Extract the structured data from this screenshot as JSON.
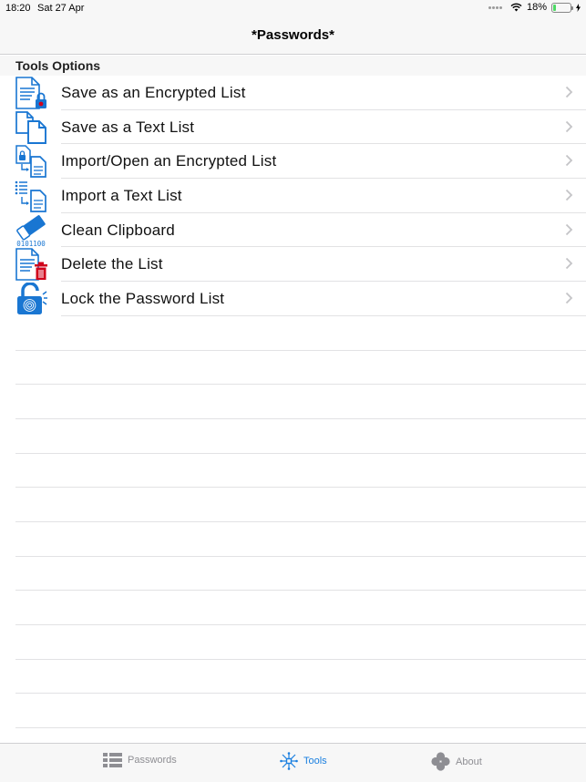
{
  "status_bar": {
    "time": "18:20",
    "date": "Sat 27 Apr",
    "battery_percent": "18%",
    "battery_level": 0.18,
    "icons": [
      "signal-dots-icon",
      "wifi-icon",
      "battery-icon",
      "charging-icon"
    ]
  },
  "nav": {
    "title": "*Passwords*"
  },
  "section": {
    "header": "Tools Options"
  },
  "tools": [
    {
      "label": "Save as an Encrypted List",
      "icon": "encrypted-document-icon"
    },
    {
      "label": "Save as a Text List",
      "icon": "copy-documents-icon"
    },
    {
      "label": "Import/Open an Encrypted List",
      "icon": "import-encrypted-icon"
    },
    {
      "label": "Import a Text List",
      "icon": "import-text-icon"
    },
    {
      "label": "Clean Clipboard",
      "icon": "eraser-binary-icon",
      "icon_text": "0101100"
    },
    {
      "label": "Delete the List",
      "icon": "delete-document-icon"
    },
    {
      "label": "Lock the Password List",
      "icon": "fingerprint-lock-icon"
    }
  ],
  "tab_bar": {
    "tabs": [
      {
        "label": "Passwords",
        "icon": "list-icon",
        "active": false
      },
      {
        "label": "Tools",
        "icon": "tools-network-icon",
        "active": true
      },
      {
        "label": "About",
        "icon": "clover-icon",
        "active": false
      }
    ]
  },
  "colors": {
    "accent": "#1a7fe0",
    "icon_blue": "#1976d2",
    "delete_red": "#d0021b",
    "battery_green": "#4cd964",
    "bar_background": "#f7f7f7",
    "separator": "#e2e2e4"
  }
}
